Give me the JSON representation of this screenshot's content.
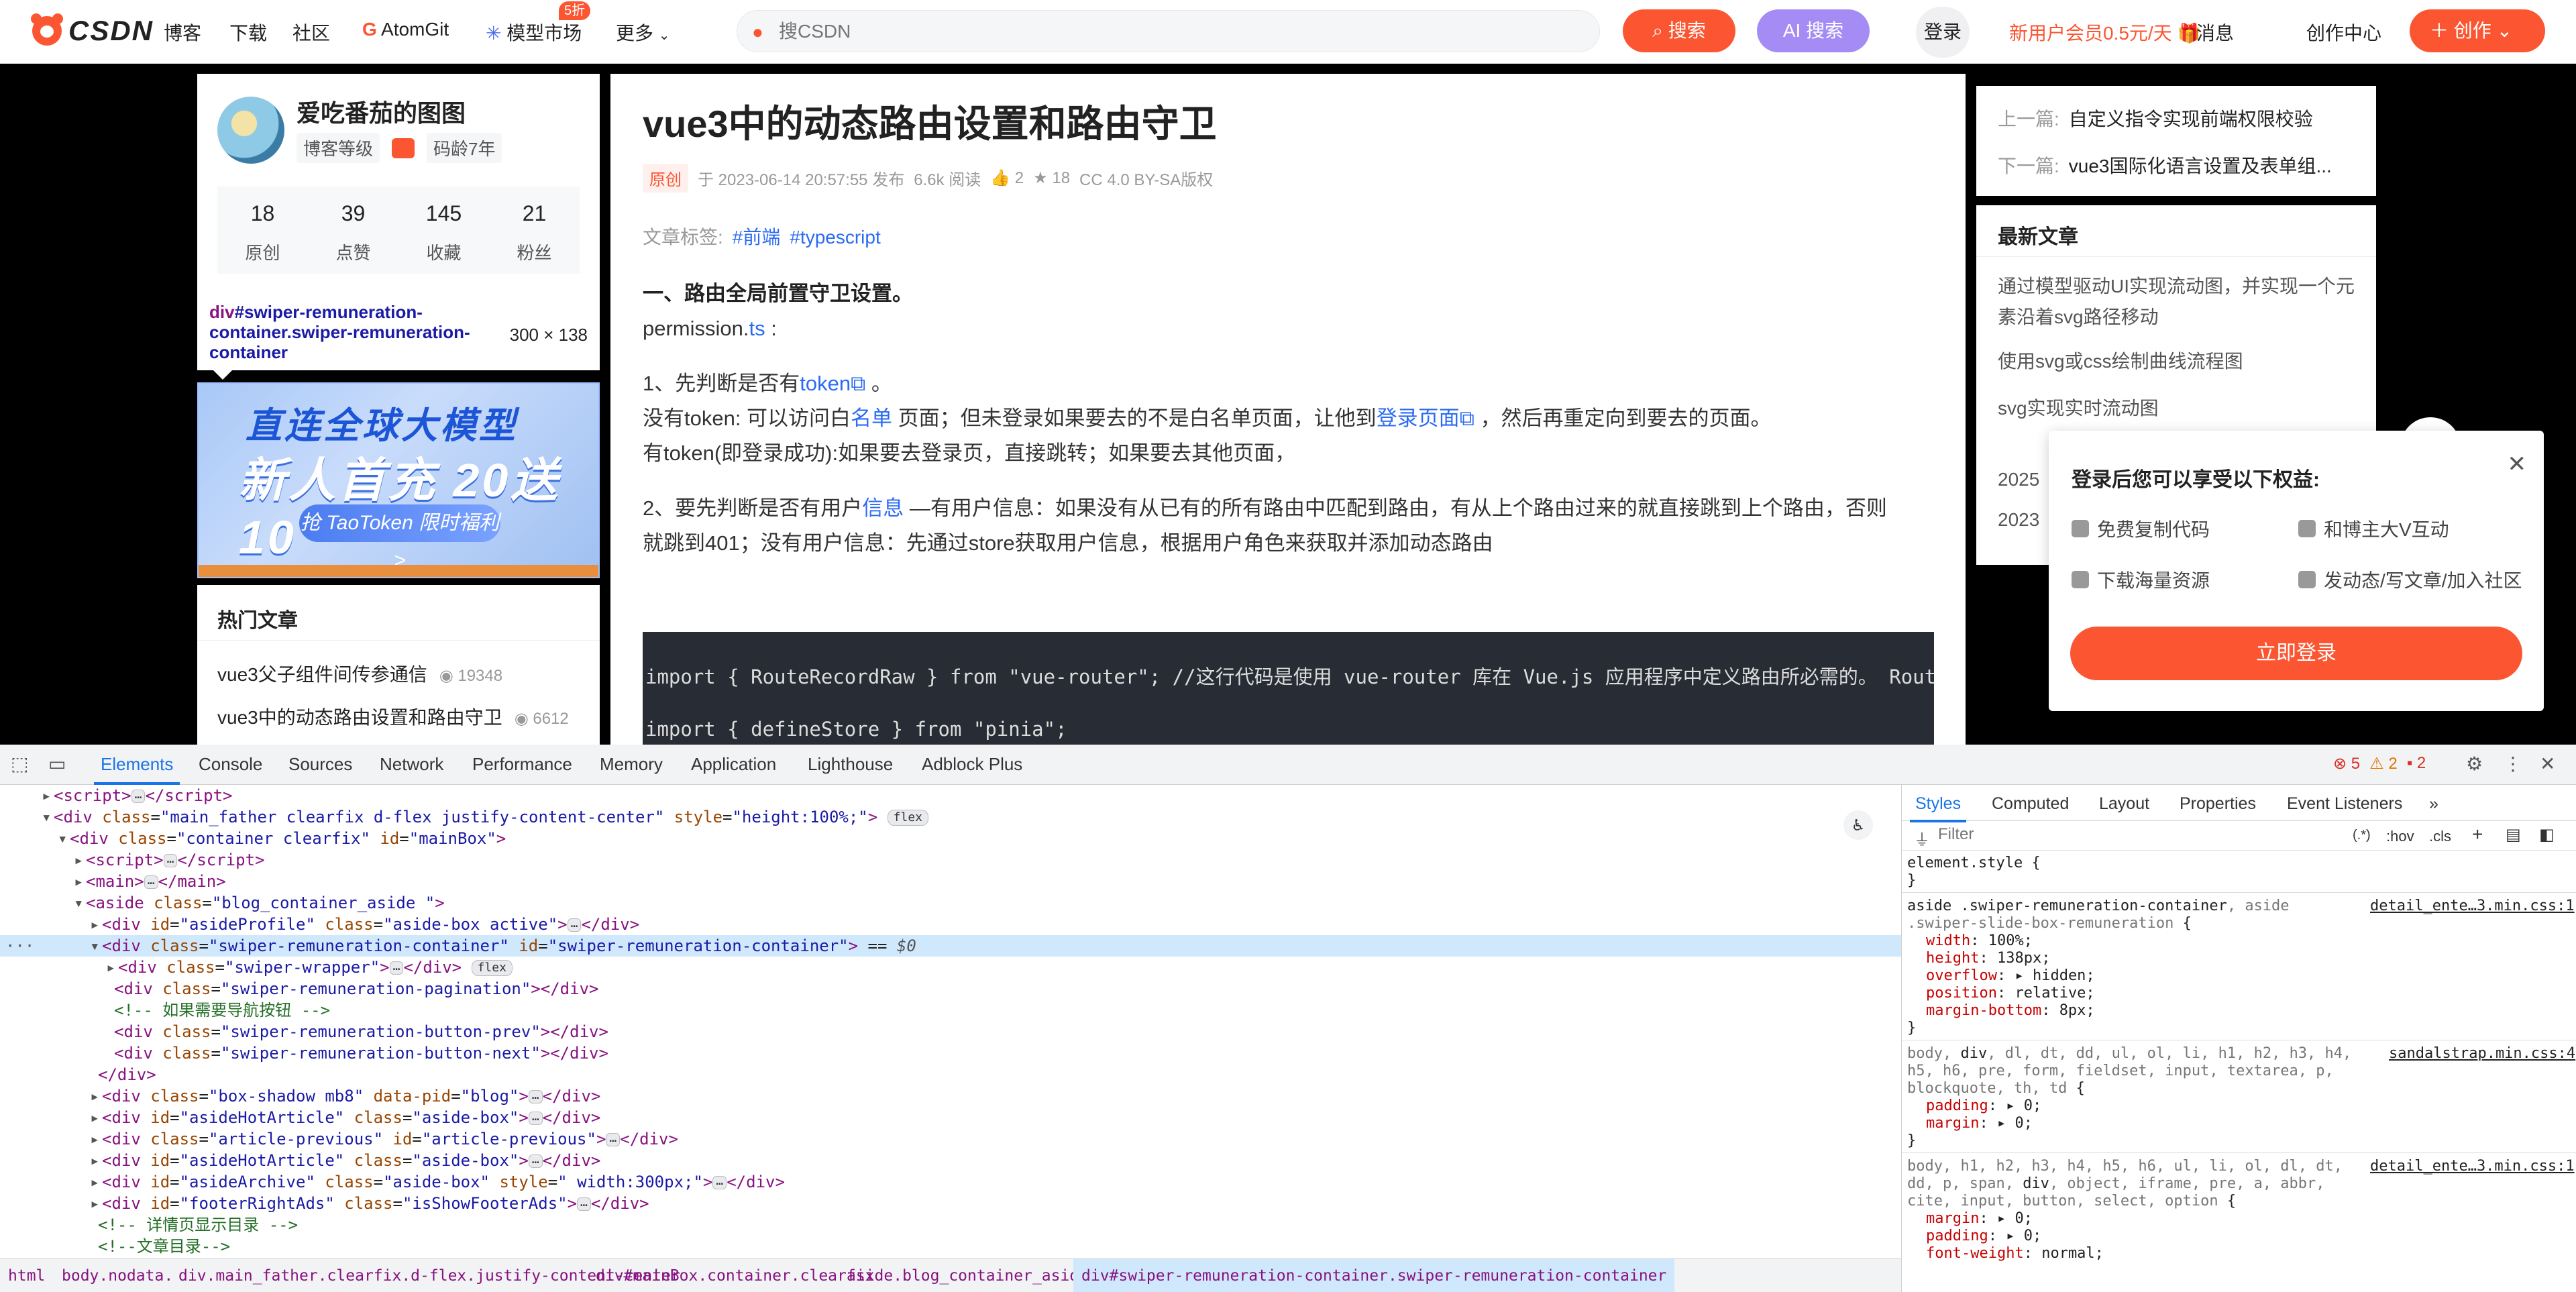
{
  "nav": {
    "brand": "CSDN",
    "items": [
      "博客",
      "下载",
      "社区",
      "AtomGit",
      "模型市场",
      "更多"
    ],
    "new_badge": "5折",
    "search_placeholder": "搜CSDN",
    "search_btn": "搜索",
    "ai_btn": "AI 搜索",
    "login": "登录",
    "vip": "新用户会员0.5元/天",
    "messages": "消息",
    "creator": "创作中心",
    "create_btn": "创作"
  },
  "profile": {
    "name": "爱吃番茄的图图",
    "level": "博客等级",
    "age": "码龄7年",
    "stats": [
      {
        "n": "18",
        "l": "原创"
      },
      {
        "n": "39",
        "l": "点赞"
      },
      {
        "n": "145",
        "l": "收藏"
      },
      {
        "n": "21",
        "l": "粉丝"
      }
    ]
  },
  "tooltip": {
    "selector_tag": "div",
    "selector_rest": "#swiper-remuneration-container.swiper-remuneration-container",
    "dims": "300 × 138"
  },
  "banner": {
    "line1": "直连全球大模型",
    "line2": "新人首充 20送10",
    "cta": "抢 TaoToken 限时福利 >"
  },
  "hot": {
    "title": "热门文章",
    "items": [
      {
        "t": "vue3父子组件间传参通信",
        "v": "19348"
      },
      {
        "t": "vue3中的动态路由设置和路由守卫",
        "v": "6612"
      }
    ]
  },
  "article": {
    "title": "vue3中的动态路由设置和路由守卫",
    "original": "原创",
    "date": "于 2023-06-14 20:57:55 发布",
    "reads": "6.6k 阅读",
    "likes": "2",
    "favs": "18",
    "license": "CC 4.0 BY-SA版权",
    "tags_label": "文章标签:",
    "tags": [
      "#前端",
      "#typescript"
    ],
    "h1": "一、路由全局前置守卫设置。",
    "file_pre": "permission.",
    "file_link": "ts",
    "file_post": " :",
    "p1_pre": "1、先判断是否有",
    "p1_link": "token",
    "p1_post": " 。",
    "p2_a": "没有token: 可以访问白",
    "p2_link1": "名单",
    "p2_b": " 页面；但未登录如果要去的不是白名单页面，让他到",
    "p2_link2": "登录页面",
    "p2_c": " ，然后再重定向到要去的页面。",
    "p3": "有token(即登录成功):如果要去登录页，直接跳转；如果要去其他页面，",
    "p4_pre": "2、要先判断是否有用户",
    "p4_link": "信息",
    "p4_post": " —有用户信息：如果没有从已有的所有路由中匹配到路由，有从上个路由过来的就直接跳到上个路由，否则",
    "p5": "就跳到401；没有用户信息：先通过store获取用户信息，根据用户角色来获取并添加动态路由",
    "code": [
      "import { RouteRecordRaw } from \"vue-router\"; //这行代码是使用 vue-router 库在 Vue.js 应用程序中定义路由所必需的。 RouteRec",
      "import { defineStore } from \"pinia\";"
    ]
  },
  "right": {
    "prev_label": "上一篇:",
    "prev": "自定义指令实现前端权限校验",
    "next_label": "下一篇:",
    "next": "vue3国际化语言设置及表单组...",
    "latest_title": "最新文章",
    "latest": [
      "通过模型驱动UI实现流动图，并实现一个元素沿着svg路径移动",
      "使用svg或css绘制曲线流程图",
      "svg实现实时流动图"
    ],
    "year1": "2025",
    "year2": "2023"
  },
  "popup": {
    "title": "登录后您可以享受以下权益:",
    "perks": [
      "免费复制代码",
      "和博主大V互动",
      "下载海量资源",
      "发动态/写文章/加入社区"
    ],
    "login_btn": "立即登录"
  },
  "devtools": {
    "tabs": [
      "Elements",
      "Console",
      "Sources",
      "Network",
      "Performance",
      "Memory",
      "Application",
      "Lighthouse",
      "Adblock Plus"
    ],
    "errors": "5",
    "warnings": "2",
    "issues": "2",
    "styles_tabs": [
      "Styles",
      "Computed",
      "Layout",
      "Properties",
      "Event Listeners"
    ],
    "filter_placeholder": "Filter",
    "filter_hov": ":hov",
    "filter_cls": ".cls",
    "breadcrumb": [
      "html",
      "body.nodata.",
      "div.main_father.clearfix.d-flex.justify-content-center",
      "div#mainBox.container.clearfix",
      "aside.blog_container_aside.",
      "div#swiper-remuneration-container.swiper-remuneration-container"
    ]
  }
}
